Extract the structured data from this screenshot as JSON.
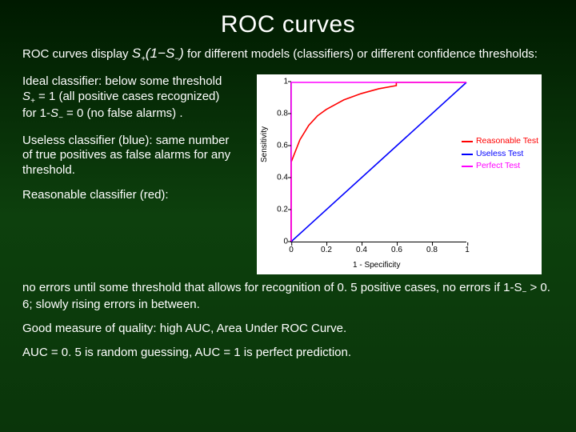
{
  "title": "ROC curves",
  "intro_pre": "ROC curves display ",
  "intro_formula_html": "S<sub>+</sub>(1−S<sub>−</sub>)",
  "intro_post": " for different models (classifiers) or different confidence thresholds:",
  "para_ideal_html": "Ideal classifier: below some threshold <span class='formula'>S<sub>+</sub></span> = 1 (all positive cases recognized) for 1-<span class='formula'>S<sub>−</sub></span> = 0 (no false alarms) .",
  "para_useless": "Useless classifier (blue): same number of true positives as false alarms for any threshold.",
  "para_reasonable_label": "Reasonable classifier (red):",
  "para_bottom1_html": "no errors until some threshold that allows for recognition of 0. 5 positive cases, no errors if 1-S<sub>−</sub> > 0. 6; slowly rising errors in between.",
  "para_bottom2": "Good measure of quality: high AUC, Area Under ROC Curve.",
  "para_bottom3": "AUC = 0. 5 is random guessing, AUC = 1 is perfect prediction.",
  "chart_data": {
    "type": "line",
    "xlabel": "1 - Specificity",
    "ylabel": "Sensitivity",
    "xlim": [
      0,
      1
    ],
    "ylim": [
      0,
      1
    ],
    "xticks": [
      0,
      0.2,
      0.4,
      0.6,
      0.8,
      1
    ],
    "yticks": [
      0,
      0.2,
      0.4,
      0.6,
      0.8,
      1
    ],
    "series": [
      {
        "name": "Reasonable Test",
        "color": "#ff0000",
        "points": [
          [
            0,
            0
          ],
          [
            0,
            0.5
          ],
          [
            0.05,
            0.64
          ],
          [
            0.1,
            0.73
          ],
          [
            0.15,
            0.79
          ],
          [
            0.2,
            0.83
          ],
          [
            0.3,
            0.89
          ],
          [
            0.4,
            0.93
          ],
          [
            0.5,
            0.96
          ],
          [
            0.6,
            0.98
          ],
          [
            0.6,
            1
          ],
          [
            1,
            1
          ]
        ]
      },
      {
        "name": "Useless Test",
        "color": "#0000ff",
        "points": [
          [
            0,
            0
          ],
          [
            1,
            1
          ]
        ]
      },
      {
        "name": "Perfect Test",
        "color": "#ff00ff",
        "points": [
          [
            0,
            0
          ],
          [
            0,
            1
          ],
          [
            1,
            1
          ]
        ]
      }
    ]
  }
}
